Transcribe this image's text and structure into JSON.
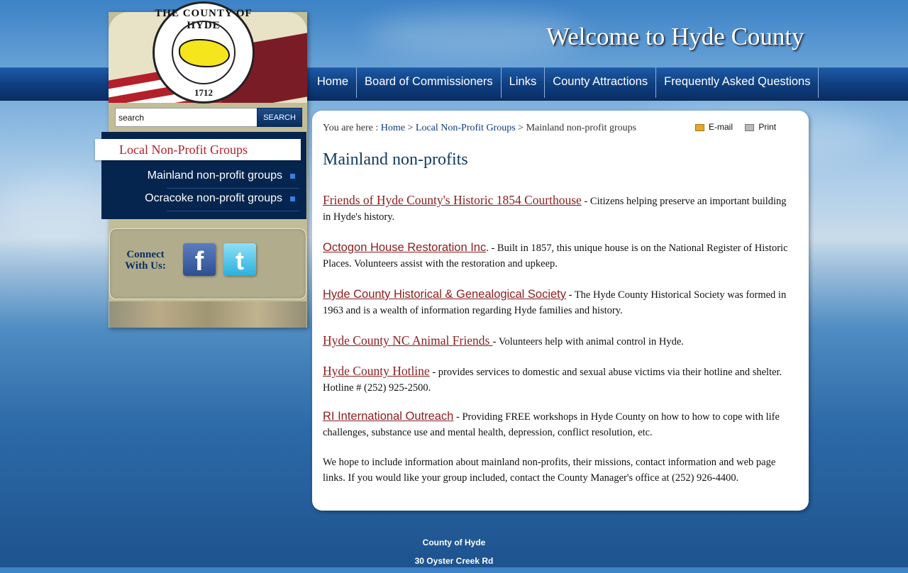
{
  "header": {
    "welcome": "Welcome to Hyde County"
  },
  "seal": {
    "top_text": "THE COUNTY OF HYDE",
    "year": "1712"
  },
  "nav": {
    "items": [
      {
        "label": "Home"
      },
      {
        "label": "Board of Commissioners"
      },
      {
        "label": "Links"
      },
      {
        "label": "County Attractions"
      },
      {
        "label": "Frequently Asked Questions"
      }
    ]
  },
  "search": {
    "value": "search",
    "button": "SEARCH"
  },
  "sidebar": {
    "title": "Local Non-Profit Groups",
    "items": [
      {
        "label": "Mainland non-profit groups"
      },
      {
        "label": "Ocracoke non-profit groups"
      }
    ],
    "connect": "Connect With Us:",
    "facebook": "f",
    "twitter": "t"
  },
  "breadcrumb": {
    "prefix": "You are here : ",
    "home": "Home",
    "sep1": " > ",
    "section": "Local Non-Profit Groups",
    "sep2": " > ",
    "current": "Mainland non-profit groups"
  },
  "tools": {
    "email": "E-mail",
    "print": "Print"
  },
  "page": {
    "title": "Mainland non-profits",
    "entries": [
      {
        "link": "Friends of Hyde County's Historic 1854 Courthouse",
        "text": " - Citizens helping preserve an important building in Hyde's history."
      },
      {
        "link": "Octogon House Restoration Inc",
        "text": ". - Built in 1857, this unique house is on the National Register of Historic Places. Volunteers assist with the restoration and upkeep."
      },
      {
        "link": "Hyde County Historical & Genealogical Society",
        "text": " - The Hyde County Historical Society was formed in 1963 and is a wealth of information regarding Hyde families and history."
      },
      {
        "link": "Hyde County NC Animal Friends ",
        "text": "- Volunteers help with animal control in Hyde."
      },
      {
        "link": "Hyde County Hotline",
        "text": " - provides services to domestic and sexual abuse victims via their hotline and shelter.  Hotline # (252) 925-2500."
      },
      {
        "link": "RI International Outreach",
        "text": " - Providing FREE workshops in Hyde County on how to how to cope with life challenges, substance use and mental health, depression, conflict resolution, etc."
      }
    ],
    "closing": "We hope to include information about mainland non-profits, their missions, contact information and web page links. If you would like your group included, contact the County Manager's office at (252) 926-4400."
  },
  "footer": {
    "line1": "County of Hyde",
    "line2": "30 Oyster Creek Rd"
  }
}
